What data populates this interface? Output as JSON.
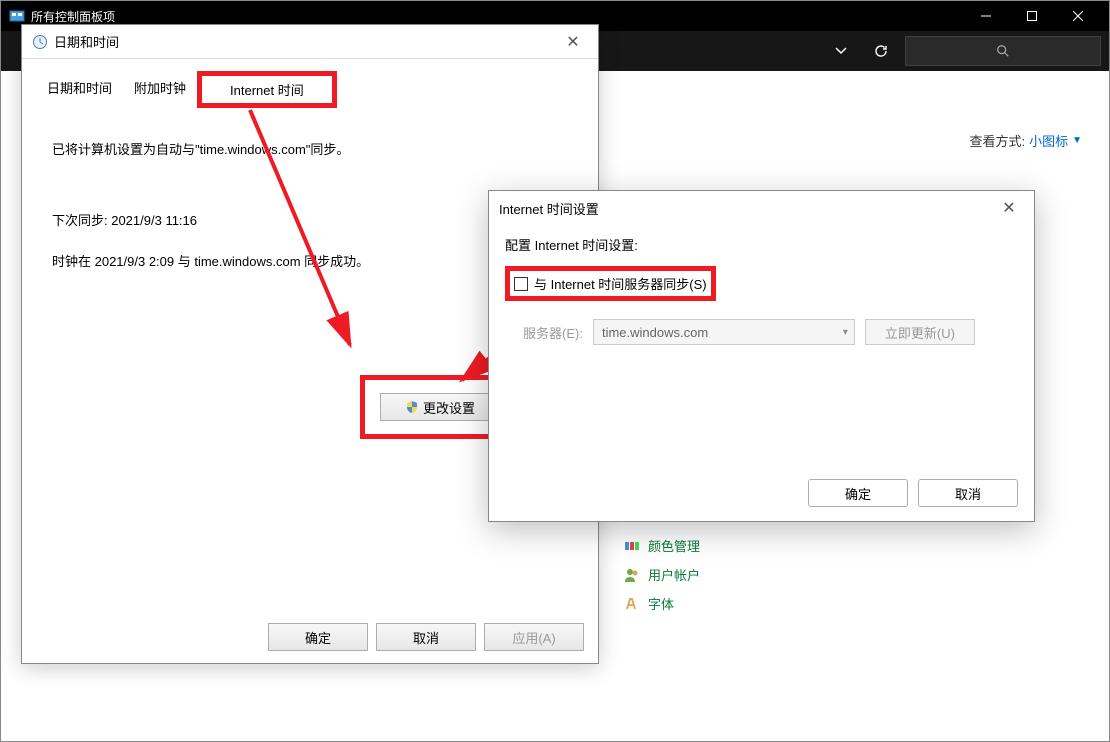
{
  "outerWindow": {
    "title": "所有控制面板项"
  },
  "viewMode": {
    "label": "查看方式:",
    "value": "小图标"
  },
  "cpItems": [
    {
      "label": "颜色管理"
    },
    {
      "label": "用户帐户"
    },
    {
      "label": "字体"
    }
  ],
  "dateDialog": {
    "title": "日期和时间",
    "tabs": [
      {
        "label": "日期和时间",
        "active": false
      },
      {
        "label": "附加时钟",
        "active": false
      },
      {
        "label": "Internet 时间",
        "active": true
      }
    ],
    "syncText": "已将计算机设置为自动与\"time.windows.com\"同步。",
    "nextSync": "下次同步: 2021/9/3 11:16",
    "lastSync": "时钟在 2021/9/3 2:09 与 time.windows.com 同步成功。",
    "changeBtn": "更改设置",
    "ok": "确定",
    "cancel": "取消",
    "apply": "应用(A)"
  },
  "inetDialog": {
    "title": "Internet 时间设置",
    "configLabel": "配置 Internet 时间设置:",
    "syncCheckbox": "与 Internet 时间服务器同步(S)",
    "serverLabel": "服务器(E):",
    "serverValue": "time.windows.com",
    "updateBtn": "立即更新(U)",
    "ok": "确定",
    "cancel": "取消"
  }
}
